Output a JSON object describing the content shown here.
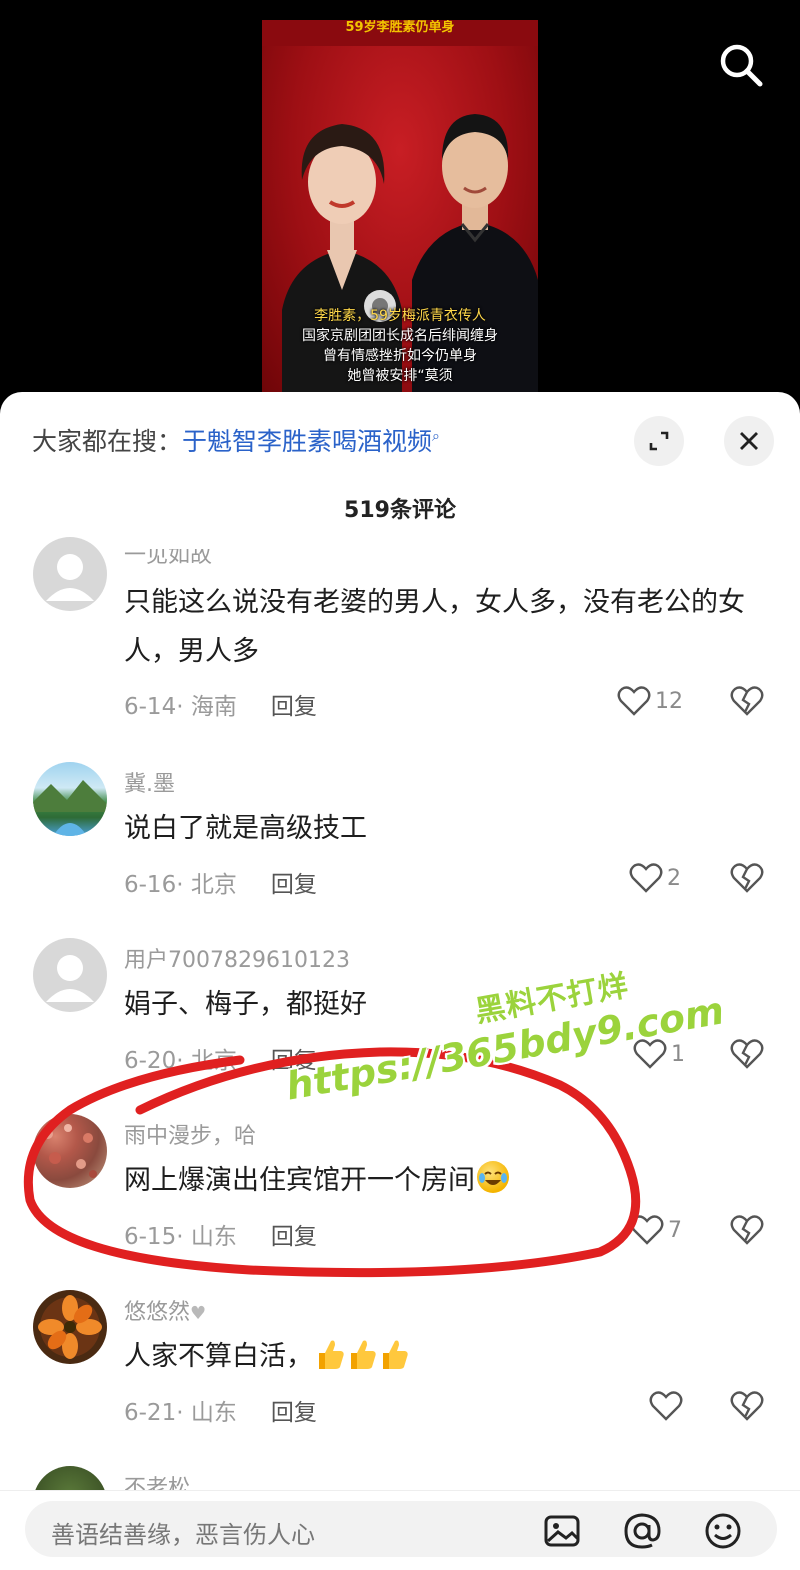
{
  "video": {
    "banner": "59岁李胜素仍单身",
    "caption_lines": [
      "李胜素，59岁梅派青衣传人",
      "国家京剧团团长成名后绯闻缠身",
      "曾有情感挫折如今仍单身",
      "她曾被安排“莫须"
    ]
  },
  "hot_search": {
    "label": "大家都在搜：",
    "keyword": "于魁智李胜素喝酒视频",
    "keyword_icon": "search-small-icon"
  },
  "comment_count": "519条评论",
  "comments": [
    {
      "user": "一见如故",
      "text": "只能这么说没有老婆的男人，女人多，没有老公的女人，男人多",
      "date": "6-14",
      "location": "海南",
      "reply": "回复",
      "likes": "12",
      "avatar": "default-avatar-icon"
    },
    {
      "user": "冀.墨",
      "text": "说白了就是高级技工",
      "date": "6-16",
      "location": "北京",
      "reply": "回复",
      "likes": "2",
      "avatar": "landscape-photo"
    },
    {
      "user": "用户7007829610123",
      "text": "娟子、梅子，都挺好",
      "date": "6-20",
      "location": "北京",
      "reply": "回复",
      "likes": "1",
      "avatar": "default-avatar-icon"
    },
    {
      "user": "雨中漫步，哈",
      "text": "网上爆演出住宾馆开一个房间",
      "date": "6-15",
      "location": "山东",
      "reply": "回复",
      "likes": "7",
      "avatar": "flowers-photo",
      "emoji": "laughing-tears-emoji"
    },
    {
      "user": "悠悠然",
      "text": "人家不算白活，",
      "date": "6-21",
      "location": "山东",
      "reply": "回复",
      "likes": "",
      "avatar": "orange-flower-photo",
      "emoji": "thumbs-up-emoji"
    },
    {
      "user": "不老松",
      "text": "",
      "date": "",
      "location": "",
      "reply": "",
      "likes": "",
      "avatar": "tree-photo"
    }
  ],
  "watermark": {
    "line1": "黑料不打烊",
    "line2": "https://365bdy9.com"
  },
  "input": {
    "placeholder": "善语结善缘，恶言伤人心"
  },
  "colors": {
    "accent_link": "#2a62c9",
    "annotation_red": "#e02020",
    "watermark_green": "#9bd33c",
    "video_red": "#b3141a"
  }
}
